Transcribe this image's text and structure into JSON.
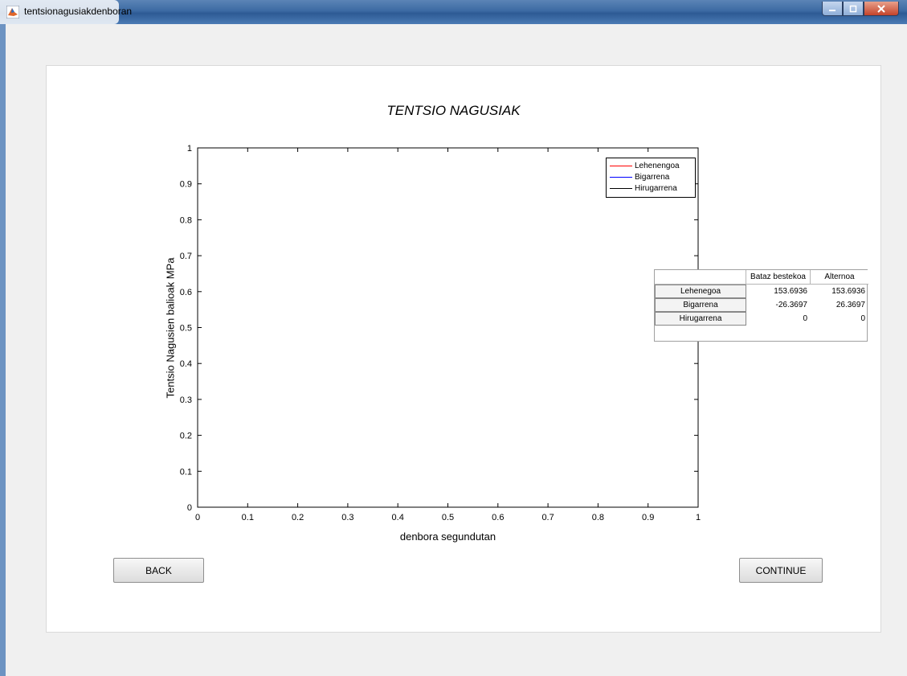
{
  "window": {
    "title": "tentsionagusiakdenboran"
  },
  "plot": {
    "title": "TENTSIO NAGUSIAK",
    "xlabel": "denbora segundutan",
    "ylabel": "Tentsio Nagusien balioak MPa",
    "x_ticks": [
      "0",
      "0.1",
      "0.2",
      "0.3",
      "0.4",
      "0.5",
      "0.6",
      "0.7",
      "0.8",
      "0.9",
      "1"
    ],
    "y_ticks": [
      "0",
      "0.1",
      "0.2",
      "0.3",
      "0.4",
      "0.5",
      "0.6",
      "0.7",
      "0.8",
      "0.9",
      "1"
    ],
    "legend": [
      {
        "label": "Lehenengoa",
        "color": "#ff0000"
      },
      {
        "label": "Bigarrena",
        "color": "#0000ff"
      },
      {
        "label": "Hirugarrena",
        "color": "#000000"
      }
    ]
  },
  "chart_data": {
    "type": "line",
    "title": "TENTSIO NAGUSIAK",
    "xlabel": "denbora segundutan",
    "ylabel": "Tentsio Nagusien balioak MPa",
    "xlim": [
      0,
      1
    ],
    "ylim": [
      0,
      1
    ],
    "grid": false,
    "legend_position": "top-right",
    "series": [
      {
        "name": "Lehenengoa",
        "color": "#ff0000",
        "x": [],
        "y": []
      },
      {
        "name": "Bigarrena",
        "color": "#0000ff",
        "x": [],
        "y": []
      },
      {
        "name": "Hirugarrena",
        "color": "#000000",
        "x": [],
        "y": []
      }
    ]
  },
  "table": {
    "columns": [
      "Bataz bestekoa",
      "Alternoa"
    ],
    "rows": [
      {
        "label": "Lehenegoa",
        "values": [
          "153.6936",
          "153.6936"
        ]
      },
      {
        "label": "Bigarrena",
        "values": [
          "-26.3697",
          "26.3697"
        ]
      },
      {
        "label": "Hirugarrena",
        "values": [
          "0",
          "0"
        ]
      }
    ]
  },
  "buttons": {
    "back": "BACK",
    "continue": "CONTINUE"
  }
}
